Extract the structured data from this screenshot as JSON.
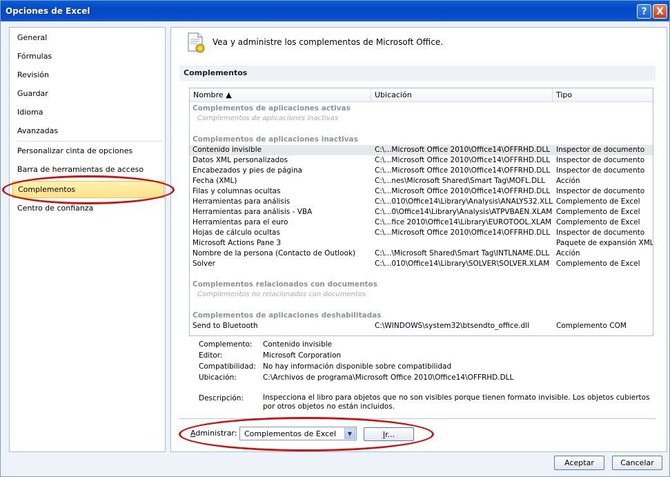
{
  "window": {
    "title": "Opciones de Excel",
    "help_glyph": "?",
    "close_glyph": "X"
  },
  "nav": {
    "items": [
      "General",
      "Fórmulas",
      "Revisión",
      "Guardar",
      "Idioma",
      "Avanzadas",
      "Personalizar cinta de opciones",
      "Barra de herramientas de acceso rápido",
      "Complementos",
      "Centro de confianza"
    ],
    "selected": "Complementos"
  },
  "header": {
    "text": "Vea y administre los complementos de Microsoft Office."
  },
  "section": {
    "title": "Complementos"
  },
  "list": {
    "columns": [
      "Nombre ▲",
      "Ubicación",
      "Tipo"
    ],
    "groups": {
      "active": {
        "label": "Complementos de aplicaciones activas",
        "empty": "Complementos de aplicaciones inactivas"
      },
      "inactive": {
        "label": "Complementos de aplicaciones inactivas"
      },
      "documents": {
        "label": "Complementos relacionados con documentos",
        "empty": "Complementos no relacionados con documentos"
      },
      "disabled": {
        "label": "Complementos de aplicaciones deshabilitadas"
      }
    },
    "inactive_rows": [
      {
        "name": "Contenido invisible",
        "location": "C:\\...Microsoft Office 2010\\Office14\\OFFRHD.DLL",
        "type": "Inspector de documento"
      },
      {
        "name": "Datos XML personalizados",
        "location": "C:\\...Microsoft Office 2010\\Office14\\OFFRHD.DLL",
        "type": "Inspector de documento"
      },
      {
        "name": "Encabezados y pies de página",
        "location": "C:\\...Microsoft Office 2010\\Office14\\OFFRHD.DLL",
        "type": "Inspector de documento"
      },
      {
        "name": "Fecha (XML)",
        "location": "C:\\...nes\\Microsoft Shared\\Smart Tag\\MOFL.DLL",
        "type": "Acción"
      },
      {
        "name": "Filas y columnas ocultas",
        "location": "C:\\...Microsoft Office 2010\\Office14\\OFFRHD.DLL",
        "type": "Inspector de documento"
      },
      {
        "name": "Herramientas para análisis",
        "location": "C:\\...010\\Office14\\Library\\Analysis\\ANALYS32.XLL",
        "type": "Complemento de Excel"
      },
      {
        "name": "Herramientas para análisis - VBA",
        "location": "C:\\...0\\Office14\\Library\\Analysis\\ATPVBAEN.XLAM",
        "type": "Complemento de Excel"
      },
      {
        "name": "Herramientas para el euro",
        "location": "C:\\...fice 2010\\Office14\\Library\\EUROTOOL.XLAM",
        "type": "Complemento de Excel"
      },
      {
        "name": "Hojas de cálculo ocultas",
        "location": "C:\\...Microsoft Office 2010\\Office14\\OFFRHD.DLL",
        "type": "Inspector de documento"
      },
      {
        "name": "Microsoft Actions Pane 3",
        "location": "",
        "type": "Paquete de expansión XML"
      },
      {
        "name": "Nombre de la persona (Contacto de Outlook)",
        "location": "C:\\...\\Microsoft Shared\\Smart Tag\\INTLNAME.DLL",
        "type": "Acción"
      },
      {
        "name": "Solver",
        "location": "C:\\...010\\Office14\\Library\\SOLVER\\SOLVER.XLAM",
        "type": "Complemento de Excel"
      }
    ],
    "disabled_rows": [
      {
        "name": "Send to Bluetooth",
        "location": "C:\\WINDOWS\\system32\\btsendto_office.dll",
        "type": "Complemento COM"
      }
    ]
  },
  "details": {
    "addin_label": "Complemento:",
    "addin_value": "Contenido invisible",
    "publisher_label": "Editor:",
    "publisher_value": "Microsoft Corporation",
    "compat_label": "Compatibilidad:",
    "compat_value": "No hay información disponible sobre compatibilidad",
    "location_label": "Ubicación:",
    "location_value": "C:\\Archivos de programa\\Microsoft Office 2010\\Office14\\OFFRHD.DLL",
    "desc_label": "Descripción:",
    "desc_value": "Inspecciona el libro para objetos que no son visibles porque tienen formato invisible. Los objetos cubiertos por otros objetos no están incluidos."
  },
  "manage": {
    "label_accel": "A",
    "label_rest": "dministrar:",
    "selected": "Complementos de Excel",
    "go_accel": "I",
    "go_rest": "r..."
  },
  "buttons": {
    "ok": "Aceptar",
    "cancel": "Cancelar"
  },
  "colors": {
    "highlight_ring": "#c81414",
    "selected_nav": "#ffe28a",
    "titlebar": "#0348c4"
  }
}
